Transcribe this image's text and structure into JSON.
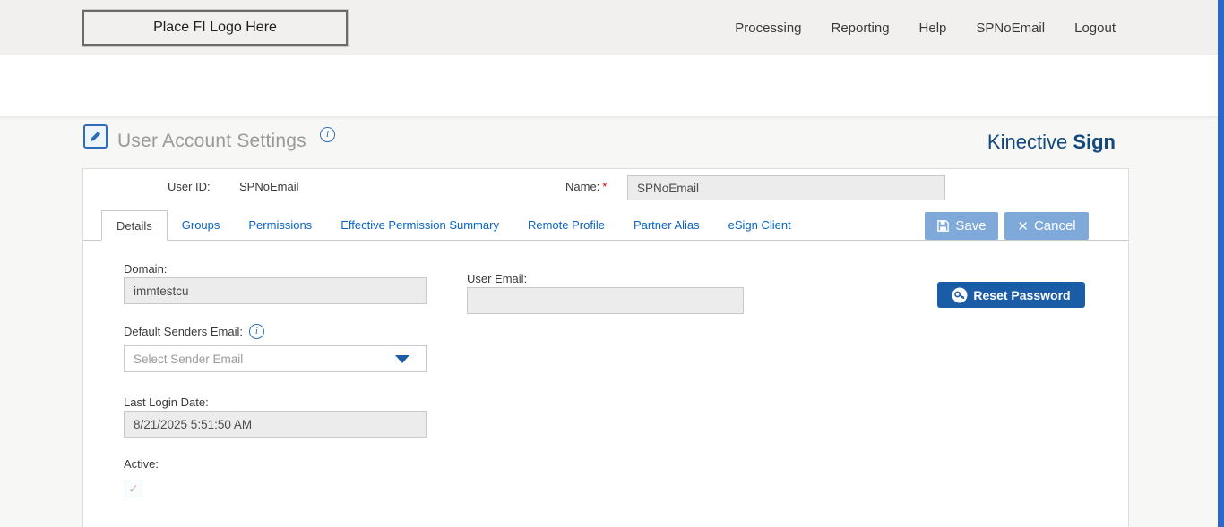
{
  "topbar": {
    "logo_placeholder": "Place FI Logo Here",
    "nav": [
      "Processing",
      "Reporting",
      "Help",
      "SPNoEmail",
      "Logout"
    ]
  },
  "header": {
    "title": "User Account Settings",
    "brand": {
      "name": "Kinective",
      "product": "Sign"
    }
  },
  "user": {
    "user_id_label": "User ID:",
    "user_id_value": "SPNoEmail",
    "name_label": "Name:",
    "required_marker": "*",
    "name_value": "SPNoEmail"
  },
  "tabs": {
    "items": [
      "Details",
      "Groups",
      "Permissions",
      "Effective Permission Summary",
      "Remote Profile",
      "Partner Alias",
      "eSign Client"
    ],
    "active": "Details"
  },
  "buttons": {
    "save": "Save",
    "cancel": "Cancel",
    "reset_password": "Reset Password"
  },
  "form": {
    "domain_label": "Domain:",
    "domain_value": "immtestcu",
    "user_email_label": "User Email:",
    "user_email_value": "",
    "default_senders_email_label": "Default Senders Email:",
    "default_senders_email_placeholder": "Select Sender Email",
    "last_login_date_label": "Last Login Date:",
    "last_login_date_value": "8/21/2025 5:51:50 AM",
    "active_label": "Active:",
    "active_checked": true
  },
  "icons": {
    "title_icon": "edit-document-icon",
    "info_icon": "info-icon",
    "save_icon": "floppy-disk-icon",
    "cancel_icon": "x-icon",
    "reset_password_icon": "key-icon",
    "dropdown_icon": "chevron-down-icon",
    "active_icon": "checkmark-icon"
  },
  "colors": {
    "brand_navy": "#11487e",
    "tab_link_blue": "#0b63c5",
    "button_light_blue": "#7ea9d8",
    "button_dark_blue": "#1b5ca6",
    "scrollbar_blue": "#2a67cd",
    "disabled_input_bg": "#ececec",
    "required_red": "#cc0000"
  }
}
